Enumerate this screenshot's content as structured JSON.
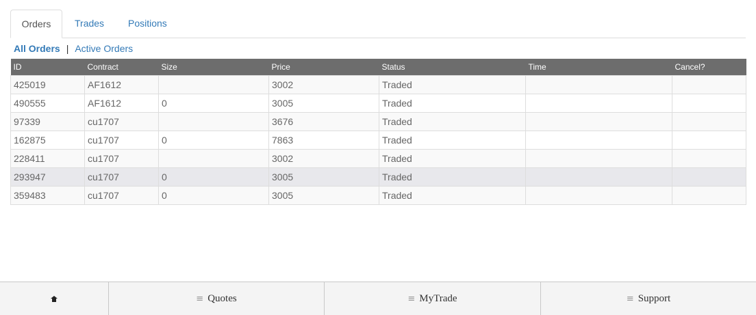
{
  "tabs": [
    {
      "label": "Orders",
      "active": true
    },
    {
      "label": "Trades",
      "active": false
    },
    {
      "label": "Positions",
      "active": false
    }
  ],
  "filter": {
    "all_label": "All Orders",
    "separator": "|",
    "active_label": "Active Orders"
  },
  "table": {
    "columns": [
      "ID",
      "Contract",
      "Size",
      "Price",
      "Status",
      "Time",
      "Cancel?"
    ],
    "rows": [
      {
        "id": "425019",
        "contract": "AF1612",
        "size": "",
        "price": "3002",
        "status": "Traded",
        "time": "",
        "cancel": ""
      },
      {
        "id": "490555",
        "contract": "AF1612",
        "size": "0",
        "price": "3005",
        "status": "Traded",
        "time": "",
        "cancel": ""
      },
      {
        "id": "97339",
        "contract": "cu1707",
        "size": "",
        "price": "3676",
        "status": "Traded",
        "time": "",
        "cancel": ""
      },
      {
        "id": "162875",
        "contract": "cu1707",
        "size": "0",
        "price": "7863",
        "status": "Traded",
        "time": "",
        "cancel": ""
      },
      {
        "id": "228411",
        "contract": "cu1707",
        "size": "",
        "price": "3002",
        "status": "Traded",
        "time": "",
        "cancel": ""
      },
      {
        "id": "293947",
        "contract": "cu1707",
        "size": "0",
        "price": "3005",
        "status": "Traded",
        "time": "",
        "cancel": ""
      },
      {
        "id": "359483",
        "contract": "cu1707",
        "size": "0",
        "price": "3005",
        "status": "Traded",
        "time": "",
        "cancel": ""
      }
    ]
  },
  "bottom_nav": {
    "home_icon": "home-icon",
    "items": [
      {
        "label": "Quotes",
        "icon": "menu-icon"
      },
      {
        "label": "MyTrade",
        "icon": "menu-icon"
      },
      {
        "label": "Support",
        "icon": "menu-icon"
      }
    ]
  },
  "colors": {
    "link": "#337ab7",
    "header_bg": "#6d6d6d",
    "row_hover": "#e8e8ec"
  }
}
